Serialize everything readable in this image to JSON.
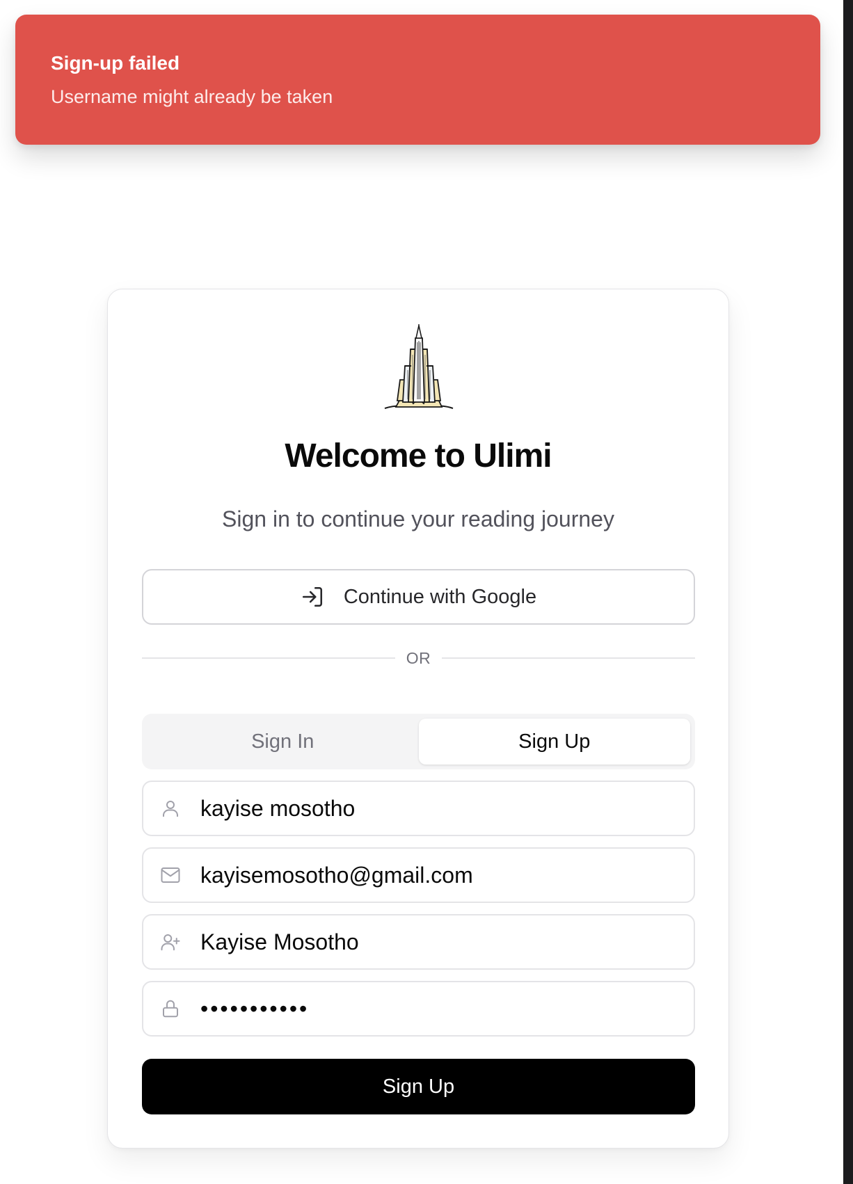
{
  "toast": {
    "title": "Sign-up failed",
    "message": "Username might already be taken",
    "color": "#df524b"
  },
  "card": {
    "logo_icon": "skyscraper-logo-icon",
    "title": "Welcome to Ulimi",
    "subtitle": "Sign in to continue your reading journey",
    "google_button": {
      "label": "Continue with Google",
      "icon": "login-arrow-icon"
    },
    "divider_text": "OR",
    "tabs": [
      {
        "label": "Sign In",
        "active": false
      },
      {
        "label": "Sign Up",
        "active": true
      }
    ],
    "fields": {
      "username": {
        "value": "kayise mosotho",
        "icon": "user-icon"
      },
      "email": {
        "value": "kayisemosotho@gmail.com",
        "icon": "mail-icon"
      },
      "display_name": {
        "value": "Kayise Mosotho",
        "icon": "user-plus-icon"
      },
      "password": {
        "value": "•••••••••••",
        "icon": "lock-icon"
      }
    },
    "submit_label": "Sign Up",
    "submit_color": "#000000"
  }
}
